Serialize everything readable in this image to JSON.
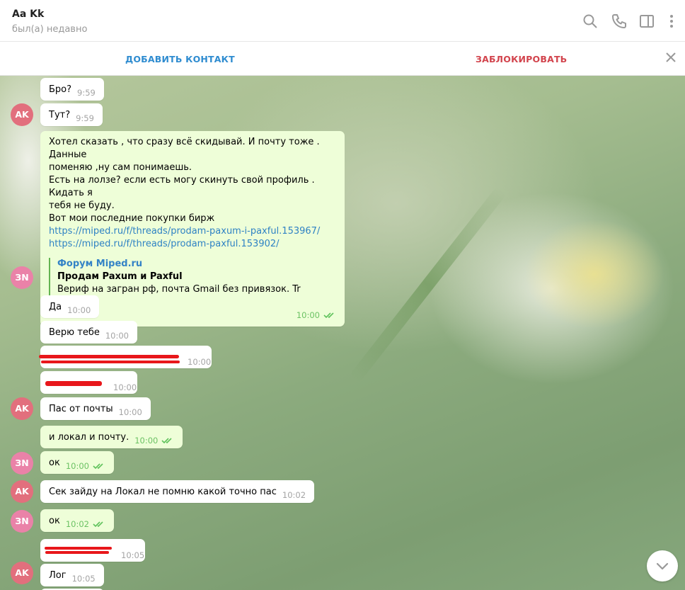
{
  "header": {
    "title": "Aa Kk",
    "status": "был(а) недавно"
  },
  "actions": {
    "add_contact": "ДОБАВИТЬ КОНТАКТ",
    "block": "ЗАБЛОКИРОВАТЬ"
  },
  "avatars": {
    "ak": "AK",
    "zn": "ЗN"
  },
  "messages": [
    {
      "text": "Бро?",
      "time": "9:59"
    },
    {
      "text": "Тут?",
      "time": "9:59"
    },
    {
      "lines": [
        "Хотел сказать , что сразу всё скидывай. И почту тоже . Данные",
        "поменяю ,ну сам понимаешь.",
        "Есть на лолзе? если есть могу скинуть свой профиль . Кидать я",
        "тебя не буду.",
        "Вот мои последние покупки бирж"
      ],
      "links": [
        "https://miped.ru/f/threads/prodam-paxum-i-paxful.153967/",
        "https://miped.ru/f/threads/prodam-paxful.153902/"
      ],
      "preview": {
        "site": "Форум Miped.ru",
        "title": "Продам Paxum и Paxful",
        "desc": "Вериф на загран рф, почта Gmail без привязок. Tr nay_say"
      },
      "time": "10:00"
    },
    {
      "text": "Да",
      "time": "10:00"
    },
    {
      "text": "Верю тебе",
      "time": "10:00"
    },
    {
      "text": "",
      "time": "10:00"
    },
    {
      "text": "",
      "time": "10:00"
    },
    {
      "text": "Пас от почты",
      "time": "10:00"
    },
    {
      "text": "и локал и почту.",
      "time": "10:00"
    },
    {
      "text": "ок",
      "time": "10:00"
    },
    {
      "text": "Сек зайду на Локал не помню какой точно пас",
      "time": "10:02"
    },
    {
      "text": "ок",
      "time": "10:02"
    },
    {
      "text": "",
      "time": "10:05"
    },
    {
      "text": "Лог",
      "time": "10:05"
    }
  ],
  "colors": {
    "accent_blue": "#2f8cd0",
    "block_red": "#d2444d",
    "outgoing_bubble": "#eefed8",
    "read_check": "#5fc25c",
    "redaction": "#e8171b"
  },
  "icons": [
    "search-icon",
    "phone-icon",
    "sidebar-toggle-icon",
    "more-vertical-icon",
    "close-icon",
    "chevron-down-icon",
    "double-check-icon"
  ]
}
